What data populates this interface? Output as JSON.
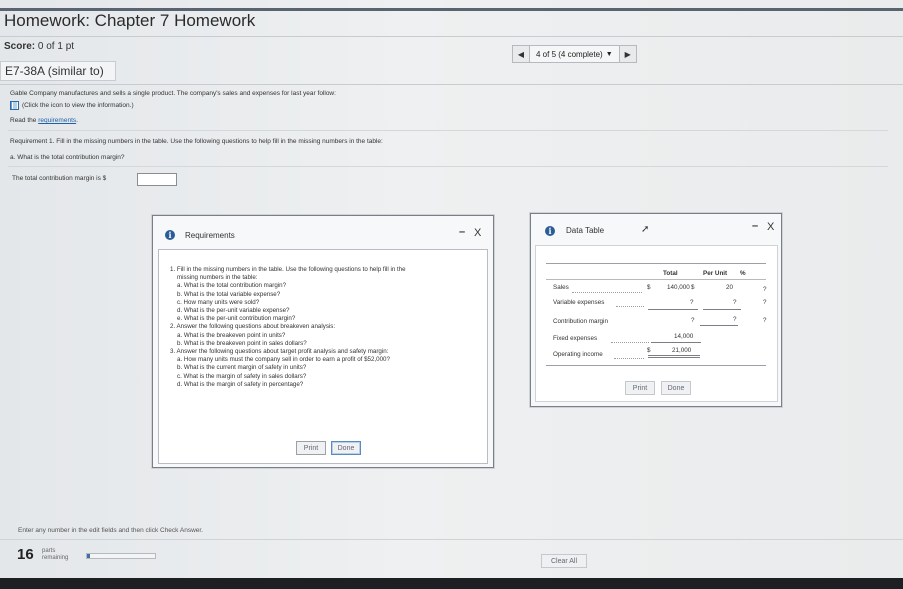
{
  "page": {
    "title": "Homework: Chapter 7 Homework",
    "score_label": "Score:",
    "score_value": "0 of 1 pt",
    "nav_position": "4 of 5 (4 complete)",
    "problem_id": "E7-38A (similar to)"
  },
  "question": {
    "intro": "Gable Company manufactures and sells a single product. The company's sales and expenses for last year follow:",
    "info_hint": "(Click the icon to view the information.)",
    "read_prefix": "Read the ",
    "read_link": "requirements",
    "read_suffix": ".",
    "requirement": "Requirement 1. Fill in the missing numbers in the table. Use the following questions to help fill in the missing numbers in the table:",
    "sub_question": "a. What is the total contribution margin?",
    "answer_prompt": "The total contribution margin is $",
    "answer_value": ""
  },
  "requirements_modal": {
    "title": "Requirements",
    "minimize": "–",
    "close": "X",
    "items": [
      {
        "text": "1.  Fill in the missing numbers in the table. Use the following questions to help fill in the",
        "cont": "missing numbers in the table:",
        "subs": [
          "a. What is the total contribution margin?",
          "b. What is the total variable expense?",
          "c. How many units were sold?",
          "d. What is the per-unit variable expense?",
          "e. What is the per-unit contribution margin?"
        ]
      },
      {
        "text": "2.  Answer the following questions about breakeven analysis:",
        "cont": "",
        "subs": [
          "a. What is the breakeven point in units?",
          "b. What is the breakeven point in sales dollars?"
        ]
      },
      {
        "text": "3.  Answer the following questions about target profit analysis and safety margin:",
        "cont": "",
        "subs": [
          "a. How many units must the company sell in order to earn a profit of $52,000?",
          "b. What is the current margin of safety in units?",
          "c. What is the margin of safety in sales dollars?",
          "d. What is the margin of safety in percentage?"
        ]
      }
    ],
    "print": "Print",
    "done": "Done"
  },
  "data_modal": {
    "title": "Data Table",
    "minimize": "–",
    "close": "X",
    "headers": {
      "total": "Total",
      "per_unit": "Per Unit",
      "pct": "%"
    },
    "rows": [
      {
        "label": "Sales",
        "dollar": "$",
        "total": "140,000",
        "pu_dollar": "$",
        "per_unit": "20",
        "pct": "?"
      },
      {
        "label": "Variable expenses",
        "dollar": "",
        "total": "?",
        "pu_dollar": "",
        "per_unit": "?",
        "pct": "?"
      },
      {
        "label": "Contribution margin",
        "dollar": "",
        "total": "?",
        "pu_dollar": "",
        "per_unit": "?",
        "pct": "?"
      },
      {
        "label": "Fixed expenses",
        "dollar": "",
        "total": "14,000",
        "pu_dollar": "",
        "per_unit": "",
        "pct": ""
      },
      {
        "label": "Operating income",
        "dollar": "$",
        "total": "21,000",
        "pu_dollar": "",
        "per_unit": "",
        "pct": ""
      }
    ],
    "print": "Print",
    "done": "Done"
  },
  "footer": {
    "instruction": "Enter any number in the edit fields and then click Check Answer.",
    "parts_count": "16",
    "parts_label_1": "parts",
    "parts_label_2": "remaining",
    "progress_fraction": 0.04,
    "clear_all": "Clear All"
  },
  "colors": {
    "accent": "#2c5c95",
    "link": "#1f5fa8",
    "progress": "#3f6fa6"
  }
}
